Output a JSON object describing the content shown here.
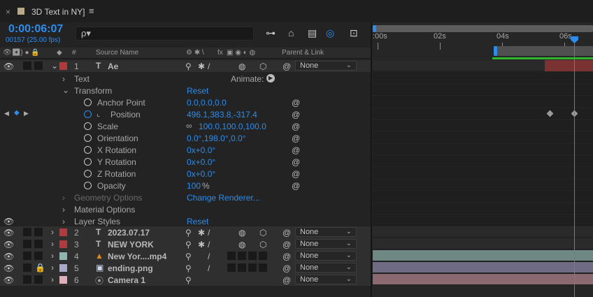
{
  "tab": {
    "close": "×",
    "title": "3D Text in NY]",
    "menu": "≡"
  },
  "time": {
    "timecode": "0:00:06:07",
    "frame_fps": "00157 (25.00 fps)"
  },
  "search": {
    "glyph": "ρ▾"
  },
  "columns": {
    "num": "#",
    "source_name": "Source Name",
    "parent": "Parent & Link",
    "fx": "fx"
  },
  "ruler": {
    "t0": ":00s",
    "t2": "02s",
    "t4": "04s",
    "t6": "06s"
  },
  "properties": {
    "text": "Text",
    "animate": "Animate:",
    "transform": "Transform",
    "reset": "Reset",
    "anchor_point": "Anchor Point",
    "anchor_val": "0.0,0.0,0.0",
    "position": "Position",
    "position_val": "496.1,383.8,-317.4",
    "scale": "Scale",
    "scale_val": "100.0,100.0,100.0",
    "orientation": "Orientation",
    "orientation_val": "0.0°,198.0°,0.0°",
    "xrot": "X Rotation",
    "xrot_val": "0x+0.0°",
    "yrot": "Y Rotation",
    "yrot_val": "0x+0.0°",
    "zrot": "Z Rotation",
    "zrot_val": "0x+0.0°",
    "opacity": "Opacity",
    "opacity_val": "100",
    "opacity_unit": "%",
    "geometry": "Geometry Options",
    "change_renderer": "Change Renderer...",
    "material": "Material Options",
    "layer_styles": "Layer Styles",
    "layer_styles_reset": "Reset"
  },
  "layers": [
    {
      "num": "1",
      "type_icon": "T",
      "name": "Ae",
      "color": "#b33a3a",
      "parent": "None"
    },
    {
      "num": "2",
      "type_icon": "T",
      "name": "2023.07.17",
      "color": "#b33a3a",
      "parent": "None"
    },
    {
      "num": "3",
      "type_icon": "T",
      "name": "NEW YORK",
      "color": "#b33a3a",
      "parent": "None"
    },
    {
      "num": "4",
      "type_icon": "▲",
      "name": "New Yor....mp4",
      "color": "#8fb5b0",
      "parent": "None"
    },
    {
      "num": "5",
      "type_icon": "▣",
      "name": "ending.png",
      "color": "#a9a9cc",
      "parent": "None"
    },
    {
      "num": "6",
      "type_icon": "⦿",
      "name": "Camera 1",
      "color": "#e0aeb9",
      "parent": "None"
    }
  ],
  "colors": {
    "accent": "#2d8ceb",
    "green": "#2db52d",
    "layer_red": "#7a3232",
    "bar_teal": "#6f8884",
    "bar_purple": "#6f6b84",
    "bar_pink": "#8a6a70"
  }
}
